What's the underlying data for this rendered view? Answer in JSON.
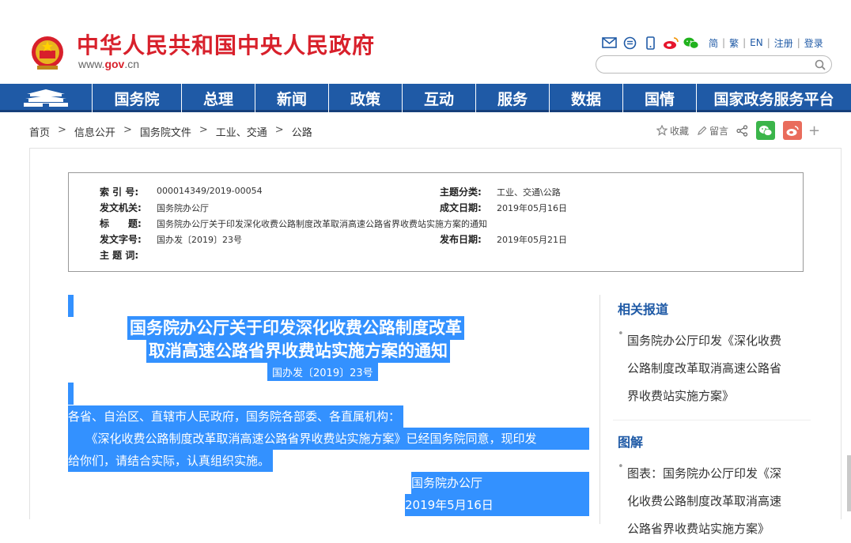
{
  "header": {
    "site_title": "中华人民共和国中央人民政府",
    "site_url_prefix": "www.",
    "site_url_domain": "gov",
    "site_url_suffix": ".cn",
    "tool_icons": [
      "mail-icon",
      "message-icon",
      "mobile-icon",
      "weibo-icon",
      "wechat-icon"
    ],
    "lang_links": [
      "简",
      "繁",
      "EN",
      "注册",
      "登录"
    ],
    "search_placeholder": ""
  },
  "nav": {
    "items": [
      "国务院",
      "总理",
      "新闻",
      "政策",
      "互动",
      "服务",
      "数据",
      "国情",
      "国家政务服务平台"
    ]
  },
  "breadcrumb": [
    "首页",
    "信息公开",
    "国务院文件",
    "工业、交通",
    "公路"
  ],
  "share": {
    "favorite": "收藏",
    "comment": "留言"
  },
  "meta": {
    "index_key": "索 引 号:",
    "index_val": "000014349/2019-00054",
    "topic_key": "主题分类:",
    "topic_val": "工业、交通\\公路",
    "issuer_key": "发文机关:",
    "issuer_val": "国务院办公厅",
    "written_key": "成文日期:",
    "written_val": "2019年05月16日",
    "title_key": "标　　题:",
    "title_val": "国务院办公厅关于印发深化收费公路制度改革取消高速公路省界收费站实施方案的通知",
    "docno_key": "发文字号:",
    "docno_val": "国办发〔2019〕23号",
    "pubdate_key": "发布日期:",
    "pubdate_val": "2019年05月21日",
    "keyword_key": "主 题 词:",
    "keyword_val": ""
  },
  "article": {
    "title_line1": "国务院办公厅关于印发深化收费公路制度改革",
    "title_line2": "取消高速公路省界收费站实施方案的通知",
    "doc_no": "国办发〔2019〕23号",
    "addressee": "各省、自治区、直辖市人民政府，国务院各部委、各直属机构：",
    "body_line1": "　　《深化收费公路制度改革取消高速公路省界收费站实施方案》已经国务院同意，现印发",
    "body_line2": "给你们，请结合实际，认真组织实施。",
    "signer": "国务院办公厅",
    "sign_date": "2019年5月16日"
  },
  "sidebar": {
    "related_title": "相关报道",
    "related_lines": [
      "国务院办公厅印发《深化收费",
      "公路制度改革取消高速公路省",
      "界收费站实施方案》"
    ],
    "graphic_title": "图解",
    "graphic_lines": [
      "图表：国务院办公厅印发《深",
      "化收费公路制度改革取消高速",
      "公路省界收费站实施方案》"
    ]
  },
  "colors": {
    "brand_red": "#d8202b",
    "nav_blue": "#1f5aa6",
    "selection": "#3391ff"
  }
}
